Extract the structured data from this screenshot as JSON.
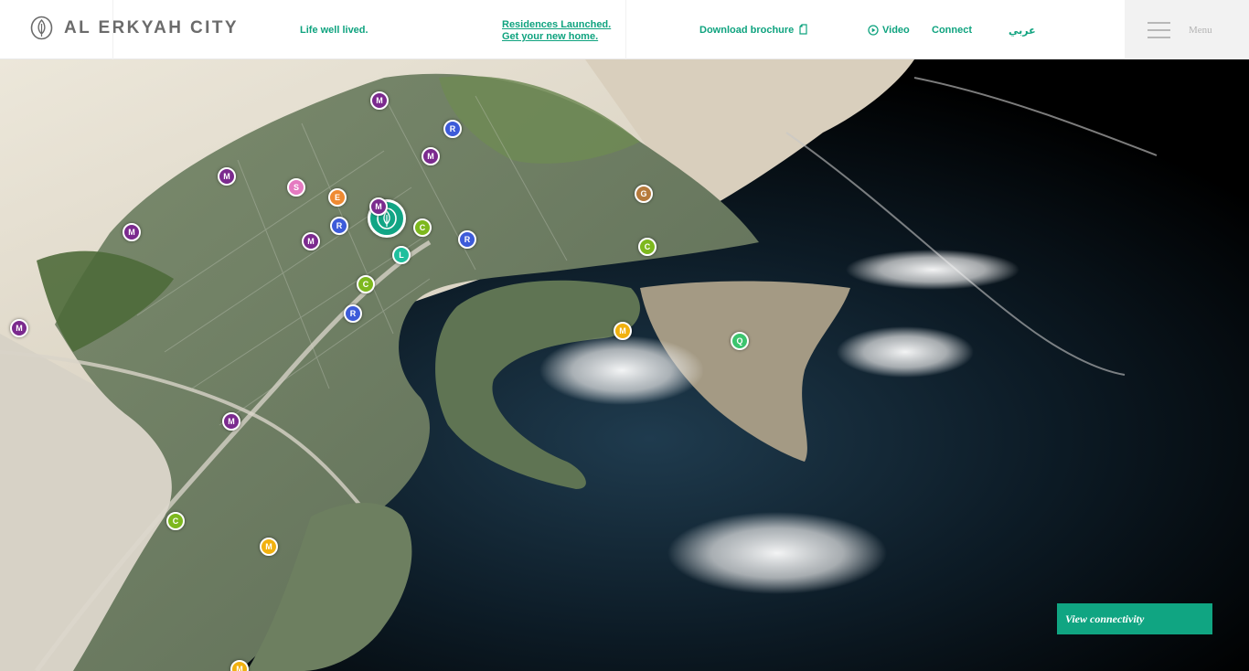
{
  "header": {
    "logo_text": "AL ERKYAH CITY",
    "tagline": "Life well lived.",
    "residences_line1": "Residences Launched.",
    "residences_line2": "Get your new home.",
    "download_label": "Download brochure",
    "video_label": "Video",
    "connect_label": "Connect",
    "arabic_label": "عربي",
    "menu_label": "Menu"
  },
  "colors": {
    "accent": "#10a582",
    "marker_m_purple": "#7b2a8e",
    "marker_r_blue": "#3d5bd9",
    "marker_c_green": "#7db81e",
    "marker_s_pink": "#e57ac1",
    "marker_e_orange": "#ef8a32",
    "marker_l_teal": "#1fbf9d",
    "marker_g_brown": "#b57a3c",
    "marker_m_yellow": "#f1b10f",
    "marker_q_green": "#3cc46e"
  },
  "map": {
    "home_marker_icon": "leaf-home-icon",
    "markers": [
      {
        "letter": "M",
        "type": "m_purple"
      },
      {
        "letter": "R",
        "type": "r_blue"
      },
      {
        "letter": "M",
        "type": "m_purple"
      },
      {
        "letter": "M",
        "type": "m_purple"
      },
      {
        "letter": "S",
        "type": "s_pink"
      },
      {
        "letter": "E",
        "type": "e_orange"
      },
      {
        "letter": "M",
        "type": "m_purple"
      },
      {
        "letter": "G",
        "type": "g_brown"
      },
      {
        "letter": "M",
        "type": "m_purple"
      },
      {
        "letter": "R",
        "type": "r_blue"
      },
      {
        "letter": "C",
        "type": "c_green"
      },
      {
        "letter": "M",
        "type": "m_purple"
      },
      {
        "letter": "R",
        "type": "r_blue"
      },
      {
        "letter": "L",
        "type": "l_teal"
      },
      {
        "letter": "C",
        "type": "c_green"
      },
      {
        "letter": "C",
        "type": "c_green"
      },
      {
        "letter": "R",
        "type": "r_blue"
      },
      {
        "letter": "M",
        "type": "m_purple"
      },
      {
        "letter": "M",
        "type": "m_yellow"
      },
      {
        "letter": "Q",
        "type": "q_green"
      },
      {
        "letter": "M",
        "type": "m_purple"
      },
      {
        "letter": "C",
        "type": "c_green"
      },
      {
        "letter": "M",
        "type": "m_yellow"
      },
      {
        "letter": "M",
        "type": "m_yellow"
      }
    ]
  },
  "cta": {
    "label": "View connectivity"
  }
}
